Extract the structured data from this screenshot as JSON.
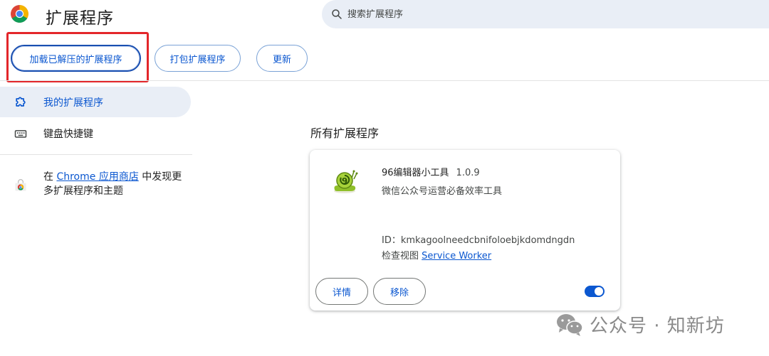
{
  "header": {
    "title": "扩展程序",
    "search_placeholder": "搜索扩展程序"
  },
  "toolbar": {
    "load_unpacked": "加载已解压的扩展程序",
    "pack": "打包扩展程序",
    "update": "更新"
  },
  "sidebar": {
    "items": [
      {
        "label": "我的扩展程序",
        "icon": "extension-puzzle-icon",
        "active": true
      },
      {
        "label": "键盘快捷键",
        "icon": "keyboard-icon",
        "active": false
      }
    ],
    "store": {
      "prefix": "在",
      "link": "Chrome 应用商店",
      "suffix": "中发现更多扩展程序和主题"
    }
  },
  "main": {
    "section_title": "所有扩展程序",
    "extension": {
      "name": "96编辑器小工具",
      "version": "1.0.9",
      "description": "微信公众号运营必备效率工具",
      "id_label": "ID：",
      "id": "kmkagoolneedcbnifoloebjkdomdngdn",
      "inspect_label": "检查视图",
      "inspect_link": "Service Worker",
      "details_button": "详情",
      "remove_button": "移除",
      "enabled": true
    }
  },
  "watermark": "公众号 · 知新坊",
  "colors": {
    "accent": "#0b57d0",
    "highlight_border": "#e3262a",
    "active_bg": "#e9eef6"
  }
}
